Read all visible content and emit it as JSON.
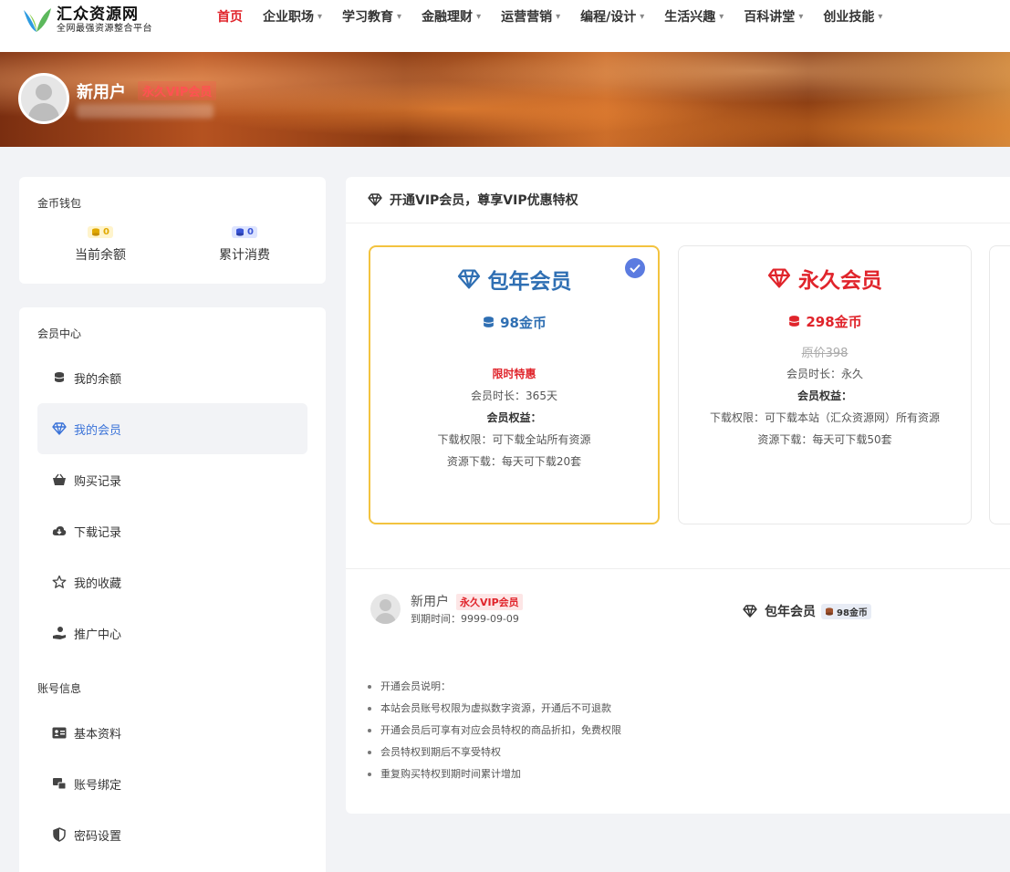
{
  "site": {
    "title": "汇众资源网",
    "subtitle": "全网最强资源整合平台"
  },
  "nav": [
    {
      "label": "首页",
      "active": true,
      "dropdown": false
    },
    {
      "label": "企业职场",
      "active": false,
      "dropdown": true
    },
    {
      "label": "学习教育",
      "active": false,
      "dropdown": true
    },
    {
      "label": "金融理财",
      "active": false,
      "dropdown": true
    },
    {
      "label": "运营营销",
      "active": false,
      "dropdown": true
    },
    {
      "label": "编程/设计",
      "active": false,
      "dropdown": true
    },
    {
      "label": "生活兴趣",
      "active": false,
      "dropdown": true
    },
    {
      "label": "百科讲堂",
      "active": false,
      "dropdown": true
    },
    {
      "label": "创业技能",
      "active": false,
      "dropdown": true
    }
  ],
  "user": {
    "name": "新用户",
    "vip_badge": "永久VIP会员",
    "expire_label": "到期时间：9999-09-09"
  },
  "wallet": {
    "section": "金币钱包",
    "balance_value": "0",
    "balance_label": "当前余额",
    "spent_value": "0",
    "spent_label": "累计消费"
  },
  "member_center": {
    "section": "会员中心",
    "items": [
      {
        "label": "我的余额",
        "icon": "coins-icon",
        "active": false
      },
      {
        "label": "我的会员",
        "icon": "diamond-icon",
        "active": true
      },
      {
        "label": "购买记录",
        "icon": "basket-icon",
        "active": false
      },
      {
        "label": "下载记录",
        "icon": "cloud-download-icon",
        "active": false
      },
      {
        "label": "我的收藏",
        "icon": "star-icon",
        "active": false
      },
      {
        "label": "推广中心",
        "icon": "hand-coin-icon",
        "active": false
      }
    ]
  },
  "account": {
    "section": "账号信息",
    "items": [
      {
        "label": "基本资料",
        "icon": "id-card-icon"
      },
      {
        "label": "账号绑定",
        "icon": "account-link-icon"
      },
      {
        "label": "密码设置",
        "icon": "shield-icon"
      }
    ]
  },
  "main": {
    "header": "开通VIP会员，尊享VIP优惠特权",
    "plans": [
      {
        "title": "包年会员",
        "price": "98金币",
        "color": "#2f6fb3",
        "promo": "限时特惠",
        "duration": "会员时长：365天",
        "benefits_label": "会员权益：",
        "download_perm": "下载权限：可下载全站所有资源",
        "download_quota": "资源下载：每天可下载20套",
        "selected": true
      },
      {
        "title": "永久会员",
        "price": "298金币",
        "color": "#e0242b",
        "original_price": "原价398",
        "duration": "会员时长：永久",
        "benefits_label": "会员权益：",
        "download_perm": "下载权限：可下载本站（汇众资源网）所有资源",
        "download_quota": "资源下载：每天可下载50套",
        "selected": false
      }
    ],
    "selected_plan": {
      "title": "包年会员",
      "price": "98金币"
    },
    "notes": [
      "开通会员说明：",
      "本站会员账号权限为虚拟数字资源，开通后不可退款",
      "开通会员后可享有对应会员特权的商品折扣，免费权限",
      "会员特权到期后不享受特权",
      "重复购买特权到期时间累计增加"
    ]
  },
  "colors": {
    "accent_red": "#e0242b",
    "accent_blue": "#3b73d8",
    "gold_border": "#f3c33f"
  }
}
